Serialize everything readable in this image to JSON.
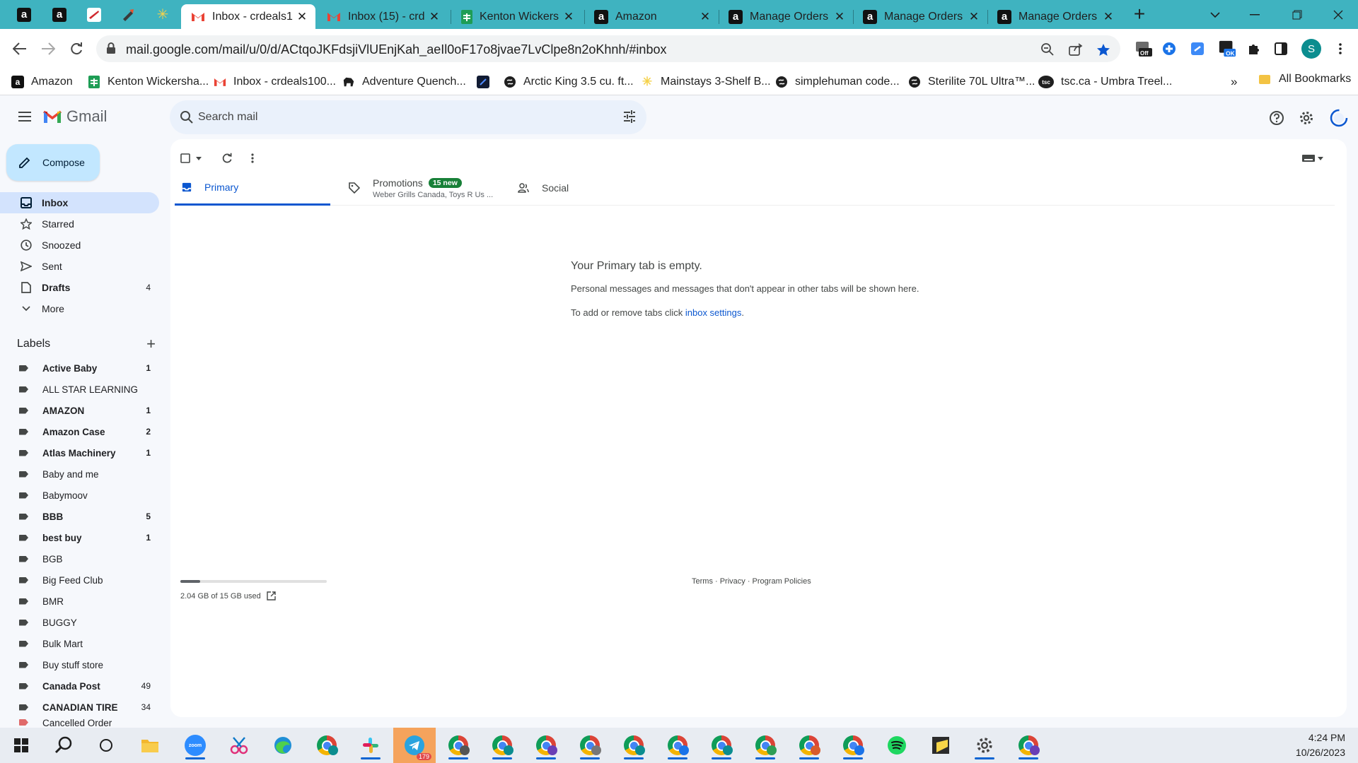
{
  "browser": {
    "tabs": [
      {
        "title": "Inbox - crdeals1",
        "active": true
      },
      {
        "title": "Inbox (15) - crd",
        "active": false
      },
      {
        "title": "Kenton Wickers",
        "active": false
      },
      {
        "title": "Amazon",
        "active": false
      },
      {
        "title": "Manage Orders",
        "active": false
      },
      {
        "title": "Manage Orders",
        "active": false
      },
      {
        "title": "Manage Orders",
        "active": false
      }
    ],
    "url": "mail.google.com/mail/u/0/d/ACtqoJKFdsjiVlUEnjKah_aeIl0oF17o8jvae7LvClpe8n2oKhnh/#inbox",
    "profile_initial": "S",
    "extension_badges": {
      "off": "Off",
      "ok": "OK"
    },
    "bookmarks": [
      "Amazon",
      "Kenton Wickersha...",
      "Inbox - crdeals100...",
      "Adventure Quench...",
      "",
      "Arctic King 3.5 cu. ft...",
      "Mainstays 3-Shelf B...",
      "simplehuman code...",
      "Sterilite 70L Ultra™...",
      "tsc.ca - Umbra Treel..."
    ],
    "bookmark_tsc_badge": "tsc",
    "all_bookmarks": "All Bookmarks"
  },
  "gmail": {
    "logo_text": "Gmail",
    "search_placeholder": "Search mail",
    "compose": "Compose",
    "nav": [
      {
        "label": "Inbox",
        "count": "",
        "icon": "inbox-icon"
      },
      {
        "label": "Starred",
        "count": "",
        "icon": "star-icon"
      },
      {
        "label": "Snoozed",
        "count": "",
        "icon": "clock-icon"
      },
      {
        "label": "Sent",
        "count": "",
        "icon": "send-icon"
      },
      {
        "label": "Drafts",
        "count": "4",
        "icon": "draft-icon"
      },
      {
        "label": "More",
        "count": "",
        "icon": "chevron-down-icon"
      }
    ],
    "labels_title": "Labels",
    "labels": [
      {
        "name": "Active Baby",
        "count": "1",
        "bold": true
      },
      {
        "name": "ALL STAR LEARNING",
        "count": "",
        "bold": false
      },
      {
        "name": "AMAZON",
        "count": "1",
        "bold": true
      },
      {
        "name": "Amazon Case",
        "count": "2",
        "bold": true
      },
      {
        "name": "Atlas Machinery",
        "count": "1",
        "bold": true
      },
      {
        "name": "Baby and me",
        "count": "",
        "bold": false
      },
      {
        "name": "Babymoov",
        "count": "",
        "bold": false
      },
      {
        "name": "BBB",
        "count": "5",
        "bold": true
      },
      {
        "name": "best buy",
        "count": "1",
        "bold": true
      },
      {
        "name": "BGB",
        "count": "",
        "bold": false
      },
      {
        "name": "Big Feed Club",
        "count": "",
        "bold": false
      },
      {
        "name": "BMR",
        "count": "",
        "bold": false
      },
      {
        "name": "BUGGY",
        "count": "",
        "bold": false
      },
      {
        "name": "Bulk Mart",
        "count": "",
        "bold": false
      },
      {
        "name": "Buy stuff store",
        "count": "",
        "bold": false
      },
      {
        "name": "Canada Post",
        "count": "49",
        "bold": true
      },
      {
        "name": "CANADIAN TIRE",
        "count": "34",
        "bold": true
      },
      {
        "name": "Cancelled Order",
        "count": "",
        "bold": false
      }
    ],
    "category_tabs": {
      "primary": "Primary",
      "promotions": "Promotions",
      "promotions_badge": "15 new",
      "promotions_sub": "Weber Grills Canada, Toys R Us ...",
      "social": "Social"
    },
    "empty_title": "Your Primary tab is empty.",
    "empty_desc": "Personal messages and messages that don't appear in other tabs will be shown here.",
    "empty_hint_prefix": "To add or remove tabs click ",
    "empty_hint_link": "inbox settings",
    "empty_hint_suffix": ".",
    "storage_text": "2.04 GB of 15 GB used",
    "storage_fraction": 0.136,
    "footer": "Terms · Privacy · Program Policies"
  },
  "taskbar": {
    "telegram_badge": "179",
    "time": "4:24 PM",
    "date": "10/26/2023"
  },
  "colors": {
    "tabstrip": "#3fb3c0",
    "accent": "#0b57d0",
    "compose": "#c2e7ff",
    "selected_nav": "#d3e3fd"
  }
}
